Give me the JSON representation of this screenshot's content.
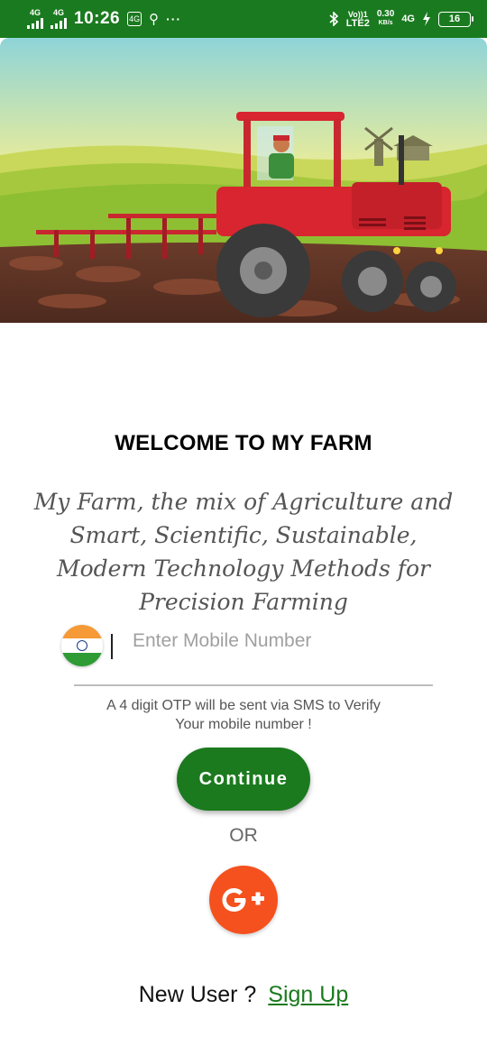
{
  "status_bar": {
    "network_1": "4G",
    "network_2": "4G",
    "time": "10:26",
    "more": "···",
    "volte": "Vo))1",
    "lte": "LTE2",
    "speed": "0.30",
    "speed_unit": "KB/s",
    "network_3": "4G",
    "battery": "16"
  },
  "welcome_title": "WELCOME TO MY FARM",
  "tagline": "My Farm, the mix of Agriculture and Smart, Scientific, Sustainable, Modern Technology Methods for Precision Farming",
  "phone": {
    "placeholder": "Enter Mobile Number",
    "value": ""
  },
  "otp_note_line1": "A 4 digit OTP will be sent via SMS to Verify",
  "otp_note_line2": "Your mobile number !",
  "continue_label": "Continue",
  "or_label": "OR",
  "google_label": "G+",
  "signup_prompt": "New User ?",
  "signup_link": "Sign Up",
  "colors": {
    "primary_green": "#1b7a1e",
    "google_orange": "#f4511e",
    "status_bar": "#1a7a1f"
  },
  "icons": [
    "bluetooth-icon",
    "charging-icon",
    "usb-icon",
    "india-flag-icon",
    "google-plus-icon"
  ]
}
